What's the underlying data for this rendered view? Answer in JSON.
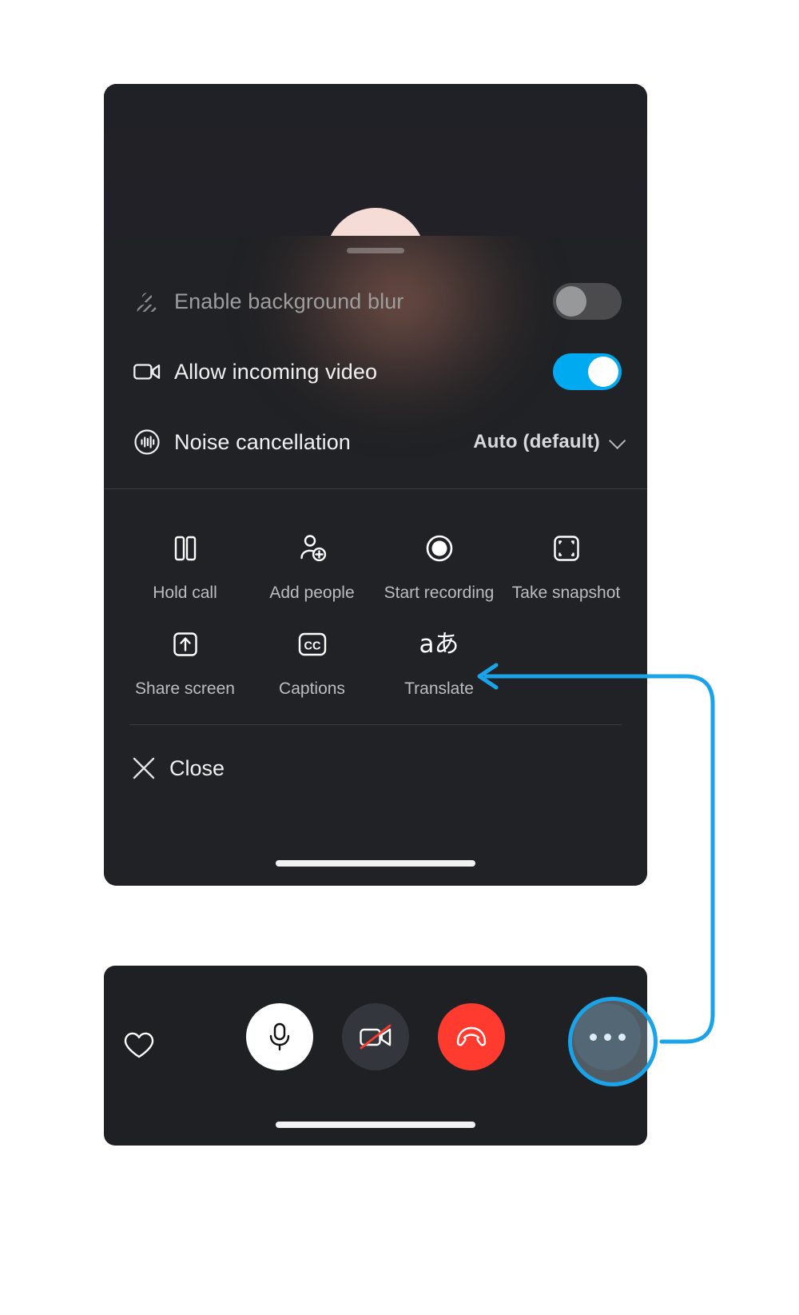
{
  "app": {
    "name": "Video call options sheet",
    "accent_color": "#00aaf0",
    "highlight_color": "#1aa3e8",
    "panel_bg": "#1f2023",
    "sheet_bg": "#212225",
    "end_call_color": "#ff3b30"
  },
  "sheet": {
    "grabber": "drag-handle",
    "settings": [
      {
        "icon": "background-blur-icon",
        "label": "Enable background blur",
        "control": "toggle",
        "state": "off",
        "disabled": true
      },
      {
        "icon": "video-camera-icon",
        "label": "Allow incoming video",
        "control": "toggle",
        "state": "on",
        "disabled": false
      },
      {
        "icon": "noise-cancellation-icon",
        "label": "Noise cancellation",
        "control": "select",
        "value": "Auto (default)",
        "chevron": "chevron-down-icon",
        "disabled": false
      }
    ],
    "actions": [
      {
        "icon": "pause-icon",
        "label": "Hold call"
      },
      {
        "icon": "add-person-icon",
        "label": "Add people"
      },
      {
        "icon": "record-icon",
        "label": "Start recording"
      },
      {
        "icon": "snapshot-icon",
        "label": "Take snapshot"
      },
      {
        "icon": "share-screen-icon",
        "label": "Share screen"
      },
      {
        "icon": "captions-cc-icon",
        "label": "Captions"
      },
      {
        "icon": "translate-icon",
        "label": "Translate",
        "glyph": "aあ"
      }
    ],
    "close": {
      "icon": "close-x-icon",
      "label": "Close"
    }
  },
  "call_bar": {
    "buttons": [
      {
        "name": "favorite-button",
        "icon": "heart-icon",
        "style": "plain"
      },
      {
        "name": "microphone-button",
        "icon": "microphone-icon",
        "style": "white"
      },
      {
        "name": "camera-button",
        "icon": "camera-off-icon",
        "style": "dark"
      },
      {
        "name": "end-call-button",
        "icon": "end-call-icon",
        "style": "red"
      },
      {
        "name": "more-options-button",
        "icon": "more-horizontal-icon",
        "style": "highlighted"
      }
    ]
  },
  "annotation": {
    "type": "callout-arrow",
    "color": "#1aa3e8",
    "from": "more-options-button",
    "to": "translate-action"
  }
}
